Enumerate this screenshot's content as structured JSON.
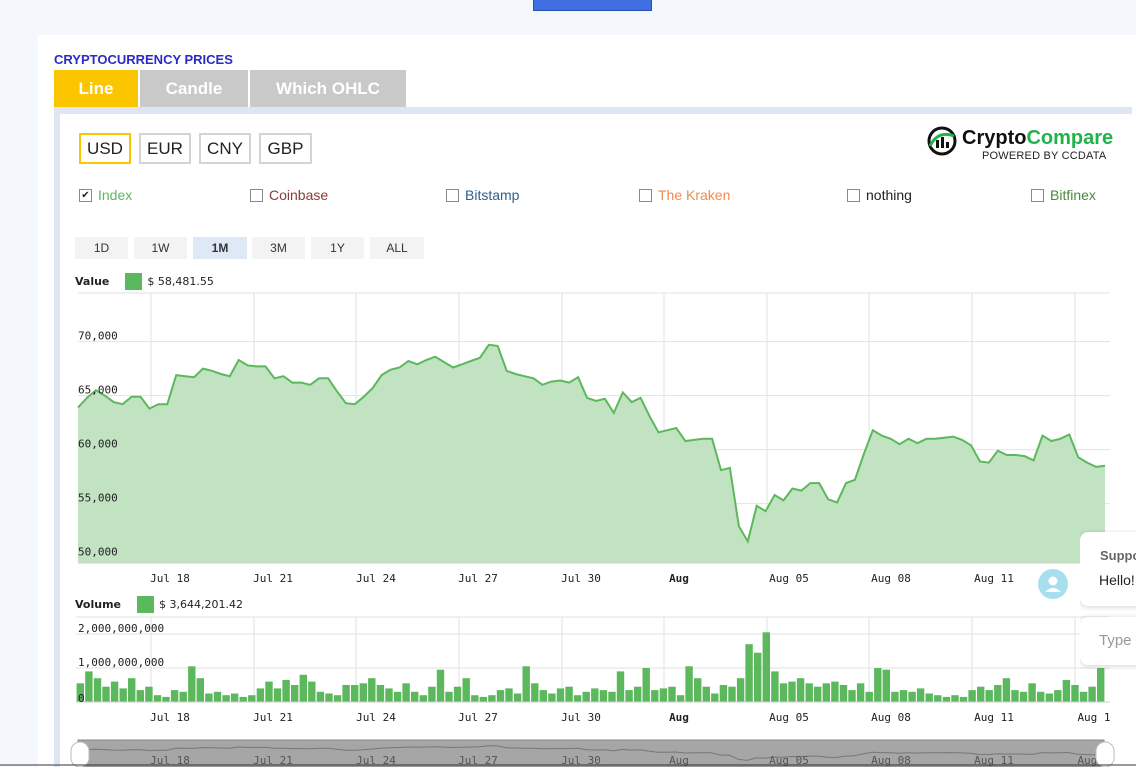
{
  "page": {
    "title": "CRYPTOCURRENCY PRICES",
    "tabs": [
      {
        "label": "Line",
        "active": true
      },
      {
        "label": "Candle",
        "active": false
      },
      {
        "label": "Which OHLC",
        "active": false
      }
    ],
    "currencies": [
      {
        "label": "USD",
        "active": true
      },
      {
        "label": "EUR",
        "active": false
      },
      {
        "label": "CNY",
        "active": false
      },
      {
        "label": "GBP",
        "active": false
      }
    ],
    "logo": {
      "brand_a": "Crypto",
      "brand_b": "Compare",
      "sub": "POWERED BY CCDATA"
    },
    "exchanges": [
      {
        "label": "Index",
        "checked": true,
        "color": "#5cb85c"
      },
      {
        "label": "Coinbase",
        "checked": false,
        "color": "#8b3a3a"
      },
      {
        "label": "Bitstamp",
        "checked": false,
        "color": "#2e5f8a"
      },
      {
        "label": "The Kraken",
        "checked": false,
        "color": "#f08a4b"
      },
      {
        "label": "nothing",
        "checked": false,
        "color": "#222222"
      },
      {
        "label": "Bitfinex",
        "checked": false,
        "color": "#4a8a3a"
      }
    ],
    "ranges": [
      {
        "label": "1D",
        "active": false
      },
      {
        "label": "1W",
        "active": false
      },
      {
        "label": "1M",
        "active": true
      },
      {
        "label": "3M",
        "active": false
      },
      {
        "label": "1Y",
        "active": false
      },
      {
        "label": "ALL",
        "active": false
      }
    ],
    "value_legend": {
      "label": "Value",
      "value": "$ 58,481.55"
    },
    "volume_legend": {
      "label": "Volume",
      "value": "$ 3,644,201.42"
    },
    "chat": {
      "name": "Suppo",
      "message": "Hello!",
      "placeholder": "Type"
    },
    "colors": {
      "accent": "#fbc500",
      "series": "#5cb85c",
      "fill": "#c1e3c1",
      "tab_inactive": "#c9c9c9",
      "title": "#2a2ac8"
    }
  },
  "chart_data": [
    {
      "type": "area",
      "name": "Value",
      "x_ticks": [
        "Jul 18",
        "Jul 21",
        "Jul 24",
        "Jul 27",
        "Jul 30",
        "Aug",
        "Aug 05",
        "Aug 08",
        "Aug 11"
      ],
      "bold_ticks": [
        "Aug"
      ],
      "y_ticks": [
        "50,000",
        "55,000",
        "60,000",
        "65,000",
        "70,000"
      ],
      "ylim": [
        49500,
        74500
      ],
      "xlim": [
        0,
        30
      ],
      "grid": true,
      "values": [
        63900,
        64800,
        65500,
        65000,
        64400,
        64200,
        64900,
        64900,
        63800,
        64200,
        64200,
        66900,
        66800,
        66700,
        67500,
        67300,
        67000,
        66800,
        68300,
        67800,
        67700,
        67700,
        66600,
        66800,
        66200,
        66200,
        66000,
        66600,
        66600,
        65400,
        64300,
        64200,
        64900,
        65700,
        66900,
        67400,
        67600,
        68200,
        67900,
        68300,
        68600,
        68100,
        67600,
        67900,
        68200,
        68500,
        69700,
        69600,
        67300,
        67000,
        66800,
        66600,
        66000,
        66300,
        66400,
        66200,
        66700,
        64800,
        64500,
        64700,
        63400,
        65300,
        64400,
        64800,
        63100,
        61600,
        61800,
        62000,
        60800,
        60900,
        61000,
        61000,
        58100,
        58300,
        52900,
        51500,
        54800,
        54300,
        55800,
        55300,
        56400,
        56200,
        56900,
        56900,
        55400,
        55100,
        56900,
        57200,
        59600,
        61800,
        61300,
        61000,
        60500,
        61000,
        60600,
        61000,
        61000,
        61100,
        61200,
        60900,
        60400,
        58900,
        58800,
        59900,
        59500,
        59500,
        59400,
        59000,
        61300,
        60800,
        61000,
        61400,
        59300,
        58800,
        58400,
        58500
      ]
    },
    {
      "type": "bar",
      "name": "Volume",
      "x_ticks": [
        "Jul 18",
        "Jul 21",
        "Jul 24",
        "Jul 27",
        "Jul 30",
        "Aug",
        "Aug 05",
        "Aug 08",
        "Aug 11",
        "Aug 1"
      ],
      "bold_ticks": [
        "Aug"
      ],
      "y_ticks": [
        "0",
        "1,000,000,000",
        "2,000,000,000"
      ],
      "ylim": [
        0,
        2500000000
      ],
      "grid": true,
      "values": [
        550000000,
        900000000,
        700000000,
        450000000,
        600000000,
        400000000,
        700000000,
        350000000,
        450000000,
        200000000,
        150000000,
        350000000,
        300000000,
        1050000000,
        700000000,
        250000000,
        300000000,
        200000000,
        250000000,
        150000000,
        200000000,
        400000000,
        600000000,
        400000000,
        650000000,
        500000000,
        800000000,
        600000000,
        300000000,
        250000000,
        200000000,
        500000000,
        500000000,
        550000000,
        700000000,
        500000000,
        400000000,
        300000000,
        550000000,
        300000000,
        200000000,
        450000000,
        950000000,
        300000000,
        450000000,
        700000000,
        200000000,
        150000000,
        200000000,
        350000000,
        400000000,
        250000000,
        1050000000,
        550000000,
        350000000,
        250000000,
        400000000,
        450000000,
        200000000,
        300000000,
        400000000,
        350000000,
        300000000,
        900000000,
        350000000,
        450000000,
        1000000000,
        350000000,
        400000000,
        450000000,
        200000000,
        1050000000,
        700000000,
        450000000,
        250000000,
        500000000,
        450000000,
        700000000,
        1700000000,
        1450000000,
        2050000000,
        900000000,
        550000000,
        600000000,
        700000000,
        550000000,
        450000000,
        550000000,
        600000000,
        500000000,
        350000000,
        550000000,
        300000000,
        1000000000,
        950000000,
        300000000,
        350000000,
        300000000,
        400000000,
        250000000,
        200000000,
        150000000,
        200000000,
        150000000,
        350000000,
        450000000,
        350000000,
        500000000,
        700000000,
        350000000,
        300000000,
        550000000,
        300000000,
        250000000,
        350000000,
        650000000,
        500000000,
        300000000,
        450000000,
        1000000000
      ]
    }
  ]
}
